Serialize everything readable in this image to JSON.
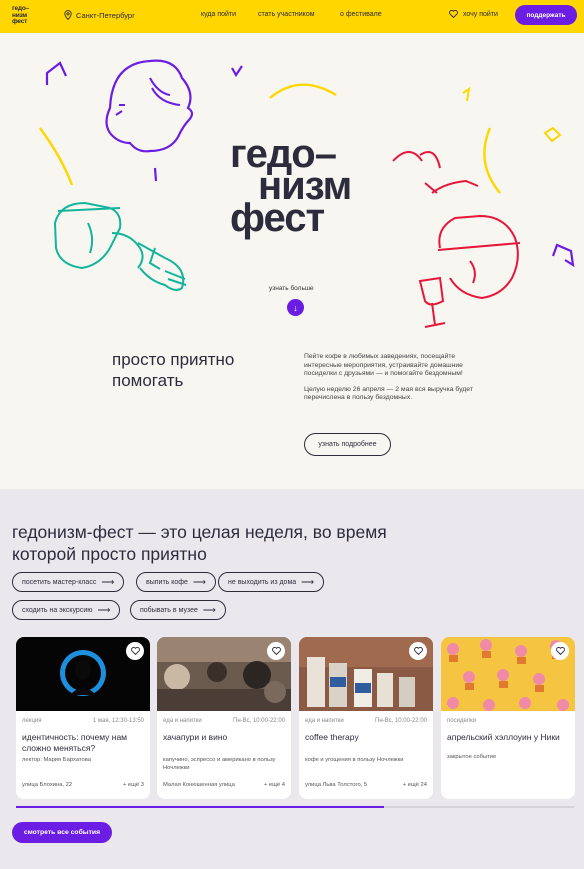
{
  "header": {
    "logo": "гедо-\nнизм\nфест",
    "city": "Санкт-Петербург",
    "nav": [
      "куда пойти",
      "стать участником",
      "о фестивале"
    ],
    "want": "хочу пойти",
    "support": "поддержать"
  },
  "hero": {
    "title_lines": [
      "гедо–",
      "низм",
      "фест"
    ],
    "learn_more": "узнать больше",
    "down_arrow": "↓"
  },
  "about": {
    "title": "просто приятно помогать",
    "p1": "Пейте кофе в любимых заведениях, посещайте интересные мероприятия, устраивайте домашние посиделки с друзьями — и помогайте бездомным!",
    "p2": "Целую неделю 26 апреля — 2 мая вся выручка будет перечислена в пользу бездомных.",
    "button": "узнать подробнее"
  },
  "events": {
    "title": "гедонизм-фест — это целая неделя, во время которой просто приятно",
    "chips": [
      "посетить мастер-класс",
      "выпить кофе",
      "не выходить из дома",
      "сходить на экскурсию",
      "побывать в музее"
    ],
    "cards": [
      {
        "category": "лекция",
        "time": "1 мая, 12:30-13:50",
        "title": "идентичность: почему нам сложно меняться?",
        "desc": "лектор: Мария Бархатова",
        "address": "улица Блохина, 22",
        "more": "+ ещё 3"
      },
      {
        "category": "еда и напитки",
        "time": "Пн-Вс, 10:00-22:00",
        "title": "хачапури и вино",
        "desc": "капучино, эспрессо и американо в пользу Ночлежки",
        "address": "Малая Конюшенная улица",
        "more": "+ ещё 4"
      },
      {
        "category": "еда и напитки",
        "time": "Пн-Вс, 10:00-22:00",
        "title": "coffee therapy",
        "desc": "кофе и угощения в пользу Ночлежки",
        "address": "улица Льва Толстого, 5",
        "more": "+ ещё 24"
      },
      {
        "category": "посиделки",
        "time": "",
        "title": "апрельский хэллоуин у Ники",
        "desc": "закрытое событие",
        "address": "",
        "more": ""
      }
    ],
    "progress": 0.66,
    "all_button": "смотреть все события"
  },
  "colors": {
    "header_bg": "#ffd600",
    "accent": "#6b1de3",
    "hero_bg": "#f8f6f1",
    "events_bg": "#ebe8ed"
  },
  "icons": {
    "city": "location-pin-icon",
    "want": "heart-icon",
    "fav": "heart-icon",
    "chip_arrow": "arrow-right-icon"
  }
}
